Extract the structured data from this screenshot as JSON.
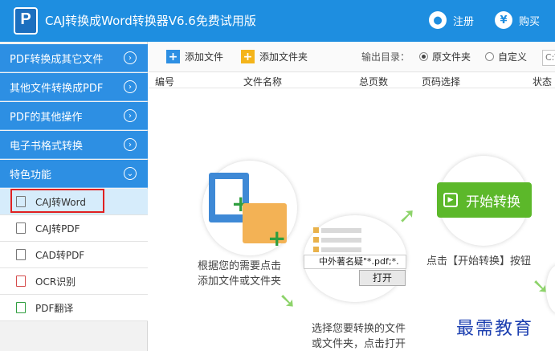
{
  "app": {
    "title": "CAJ转换成Word转换器V6.6免费试用版",
    "logo_letter": "P",
    "register_label": "注册",
    "buy_label": "购买"
  },
  "sidebar": {
    "categories": [
      {
        "label": "PDF转换成其它文件"
      },
      {
        "label": "其他文件转换成PDF"
      },
      {
        "label": "PDF的其他操作"
      },
      {
        "label": "电子书格式转换"
      },
      {
        "label": "特色功能"
      }
    ],
    "items": [
      {
        "label": "CAJ转Word",
        "active": true
      },
      {
        "label": "CAJ转PDF"
      },
      {
        "label": "CAD转PDF"
      },
      {
        "label": "OCR识别"
      },
      {
        "label": "PDF翻译"
      }
    ]
  },
  "toolbar": {
    "add_file": "添加文件",
    "add_folder": "添加文件夹",
    "output_dir_label": "输出目录：",
    "opt_source_folder": "原文件夹",
    "opt_custom": "自定义",
    "output_path_value": "C:\\"
  },
  "table": {
    "columns": [
      "编号",
      "文件名称",
      "总页数",
      "页码选择",
      "状态"
    ]
  },
  "guide": {
    "step1_line1": "根据您的需要点击",
    "step1_line2": "添加文件或文件夹",
    "step2_file_text": "中外著名疑\"*.pdf;*.",
    "step2_open": "打开",
    "step2_line1": "选择您要转换的文件",
    "step2_line2": "或文件夹，点击打开",
    "step3_button": "开始转换",
    "step3_text": "点击【开始转换】按钮"
  },
  "watermark": "最需教育",
  "colors": {
    "titlebar": "#1e8ee0",
    "sidebar_category": "#2d8fe3",
    "start_green": "#5cb82a",
    "highlight_red": "#e02020"
  }
}
